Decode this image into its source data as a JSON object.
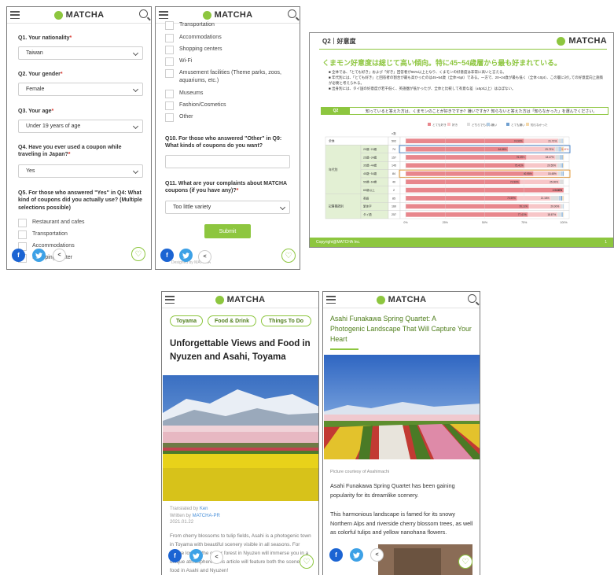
{
  "brand": "MATCHA",
  "survey": {
    "q1": {
      "label": "Q1. Your nationality",
      "value": "Taiwan"
    },
    "q2": {
      "label": "Q2. Your gender",
      "value": "Female"
    },
    "q3": {
      "label": "Q3. Your age",
      "value": "Under 19 years of age"
    },
    "q4": {
      "label": "Q4. Have you ever used a coupon while traveling in Japan?",
      "value": "Yes"
    },
    "q5": {
      "label": "Q5. For those who answered \"Yes\" in Q4: What kind of coupons did you actually use? (Multiple selections possible)",
      "options": [
        "Restaurant and cafes",
        "Transportation",
        "Accommodations",
        "Shopping center"
      ]
    },
    "q9_options": [
      "Transportation",
      "Accommodations",
      "Shopping centers",
      "Wi-Fi",
      "Amusement facilities (Theme parks, zoos, aquariums, etc.)",
      "Museums",
      "Fashion/Cosmetics",
      "Other"
    ],
    "q10": {
      "label": "Q10. For those who answered \"Other\" in Q9: What kinds of coupons do you want?"
    },
    "q11": {
      "label": "Q11. What are your complaints about MATCHA coupons (if you have any)?",
      "value": "Too little variety"
    },
    "submit_label": "Submit",
    "footnote": "Designed by MATCHA"
  },
  "slide": {
    "section": "Q2｜好意度",
    "headline": "くまモン好意度は総じて高い傾向。特に45~54歳層から最も好まれている。",
    "bullets": [
      "全体では、「とても好き」および「好き」回答者が96%以上となり、くまモンの好意度は非常に高いと言える。",
      "年代別には、「とても好き」と回答者の割合が最も高かったのは45~54歳（全体+6pt）である。一方で、20~24歳が最も低く（全体-10pt）、この層に対しての好意度向上施策が必要と考えられる。",
      "出身別には、タイ国の好意度が若干低く、英語圏が低かったが、全体と比較して有意な差（±5pt以上）はほぼない。"
    ],
    "question_tag": "Q2",
    "question": "知っていると答えた方は、くまモンのことが好きですか？嫌いですか？知らないと答えた方は「知らなかった」を選んでください。",
    "footer": "Copyright@MATCHA Inc.",
    "page_number": "1",
    "n_header": "n数"
  },
  "chart_data": {
    "type": "bar",
    "stacked": true,
    "orientation": "horizontal",
    "title": "",
    "legend": [
      "とても好き",
      "好き",
      "どちらでもない",
      "嫌い",
      "とても嫌い",
      "知らなかった"
    ],
    "legend_placement": "top",
    "colors": [
      "#e8868c",
      "#f7c6c8",
      "#dddddd",
      "#b3cde4",
      "#6f9fd0",
      "#f4d7a8"
    ],
    "groups": [
      "全体",
      "年代別",
      "",
      "",
      "",
      "",
      "",
      "記事閲読別",
      "",
      ""
    ],
    "categories": [
      "全体",
      "20歳~24歳",
      "25歳~34歳",
      "35歳~44歳",
      "45歳~54歳",
      "55歳~64歳",
      "65歳以上",
      "英語",
      "繁体字",
      "タイ語"
    ],
    "n": [
      502,
      74,
      157,
      145,
      84,
      40,
      2,
      85,
      160,
      257
    ],
    "series": [
      {
        "name": "とても好き",
        "values": [
          74.9,
          64.9,
          76.4,
          75.4,
          80.9,
          72.5,
          100.0,
          70.6,
          78.1,
          77.4
        ]
      },
      {
        "name": "好き",
        "values": [
          21.7,
          29.7,
          18.4,
          20.6,
          15.5,
          25.0,
          0,
          21.2,
          20.0,
          18.7
        ]
      },
      {
        "name": "どちらでもない",
        "values": [
          2.0,
          2.0,
          2.5,
          2.0,
          2.0,
          2.5,
          0,
          5.0,
          1.3,
          2.2
        ]
      },
      {
        "name": "嫌い",
        "values": [
          0.8,
          2.0,
          1.5,
          1.0,
          1.0,
          0,
          0,
          1.6,
          0.6,
          0.9
        ]
      },
      {
        "name": "とても嫌い",
        "values": [
          0.3,
          0,
          0.6,
          0.5,
          0.6,
          0,
          0,
          0.8,
          0,
          0.4
        ]
      },
      {
        "name": "知らなかった",
        "values": [
          0.3,
          1.4,
          0.6,
          0.5,
          0,
          0,
          0,
          0.8,
          0,
          0.4
        ]
      }
    ],
    "data_labels": [
      [
        "74.90%",
        "21.71%"
      ],
      [
        "64.86%",
        "29.73%",
        "5.41%"
      ],
      [
        "76.39%",
        "18.47%"
      ],
      [
        "75.41%",
        "20.55%"
      ],
      [
        "80.95%",
        "15.48%"
      ],
      [
        "72.50%",
        "25.00%"
      ],
      [
        "100.00%",
        "0.00%"
      ],
      [
        "70.59%",
        "21.18%"
      ],
      [
        "78.13%",
        "20.00%"
      ],
      [
        "77.43%",
        "18.67%"
      ]
    ],
    "xlim": [
      0,
      100
    ],
    "xticks": [
      "0%",
      "25%",
      "50%",
      "75%",
      "100%"
    ],
    "highlighted": [
      "20歳~24歳",
      "45歳~54歳"
    ],
    "highlight_colors": [
      "#3d7cc9",
      "#e3952c"
    ]
  },
  "article1": {
    "tags": [
      "Toyama",
      "Food & Drink",
      "Things To Do"
    ],
    "title": "Unforgettable Views and Food in Nyuzen and Asahi, Toyama",
    "translated_by_label": "Translated by",
    "translator": "Ken",
    "written_by_label": "Written by",
    "writer": "MATCHA-PR",
    "date": "2021.01.22",
    "body": "From cherry blossoms to tulip fields, Asahi is a photogenic town in Toyama with beautiful scenery visible in all seasons. For nature lovers, the cedar forest in Nyuzen will immerse you in a unique atmosphere. This article will feature both the scenery and food in Asahi and Nyuzen!"
  },
  "article2": {
    "title": "Asahi Funakawa Spring Quartet: A Photogenic Landscape That Will Capture Your Heart",
    "caption": "Picture courtesy of Asahimachi",
    "para1": "Asahi Funakawa Spring Quartet has been gaining popularity for its dreamlike scenery.",
    "para2": "This harmonious landscape is famed for its snowy Northern Alps and riverside cherry blossom trees, as well as colorful tulips and yellow nanohana flowers."
  },
  "icons": {
    "facebook": "f",
    "twitter": "twitter-bird",
    "share": "share-icon",
    "favorite": "heart-icon"
  }
}
